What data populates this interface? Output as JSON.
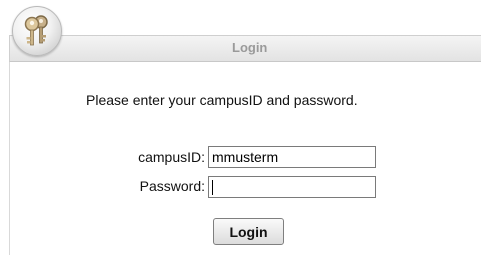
{
  "header": {
    "title": "Login"
  },
  "form": {
    "intro": "Please enter your campusID and password.",
    "campus_label": "campusID:",
    "campus_value": "mmusterm",
    "password_label": "Password:",
    "password_value": "",
    "submit_label": "Login"
  },
  "icons": {
    "logo": "keys-icon"
  }
}
